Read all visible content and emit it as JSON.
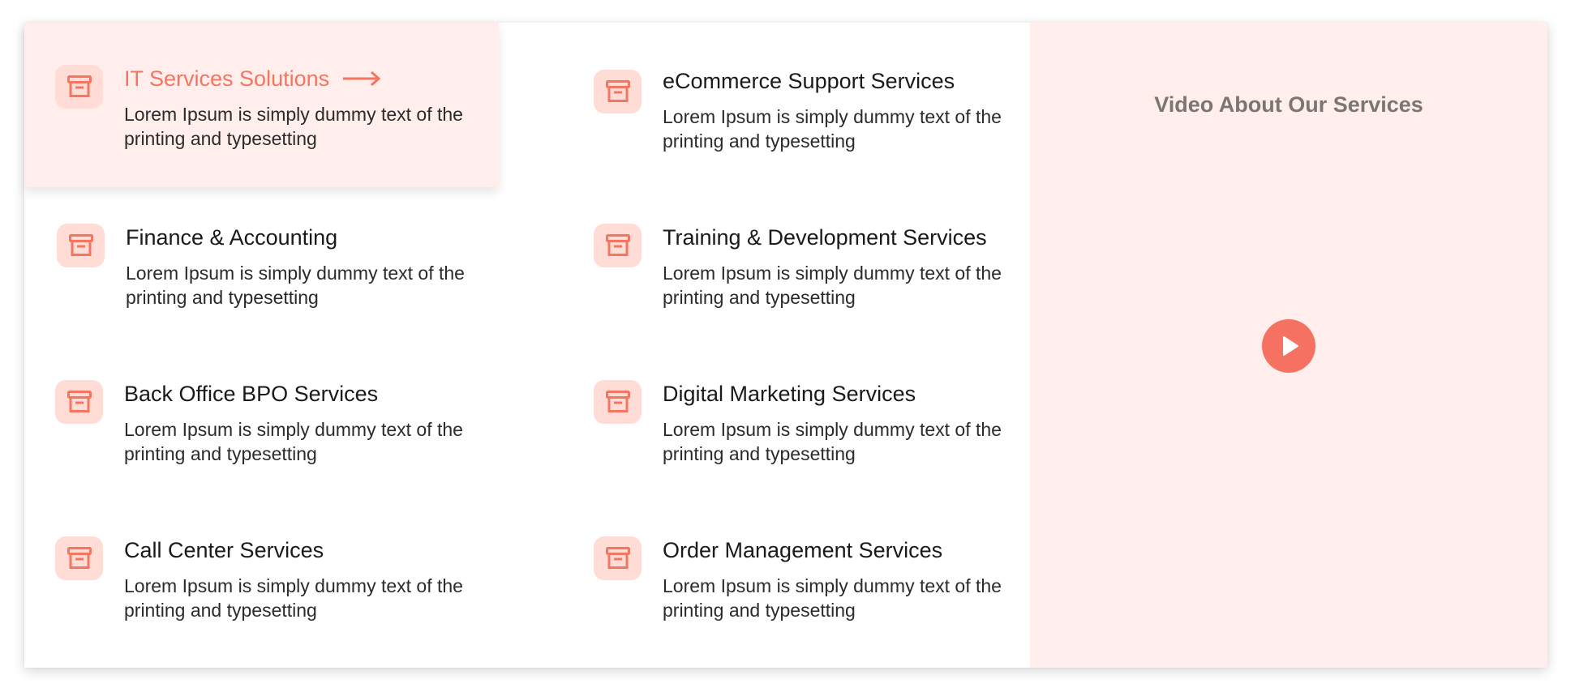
{
  "services": {
    "items": [
      {
        "title": "IT Services Solutions",
        "desc": "Lorem Ipsum is simply dummy text of the printing and typesetting",
        "active": true,
        "icon": "archive-box-icon"
      },
      {
        "title": "eCommerce Support Services",
        "desc": "Lorem Ipsum is simply dummy text of the printing and typesetting",
        "active": false,
        "icon": "archive-box-icon"
      },
      {
        "title": "Finance & Accounting",
        "desc": "Lorem Ipsum is simply dummy text of the printing and typesetting",
        "active": false,
        "icon": "archive-box-icon"
      },
      {
        "title": "Training & Development Services",
        "desc": "Lorem Ipsum is simply dummy text of the printing and typesetting",
        "active": false,
        "icon": "archive-box-icon"
      },
      {
        "title": "Back Office BPO Services",
        "desc": "Lorem Ipsum is simply dummy text of the printing and typesetting",
        "active": false,
        "icon": "archive-box-icon"
      },
      {
        "title": "Digital Marketing Services",
        "desc": "Lorem Ipsum is simply dummy text of the printing and typesetting",
        "active": false,
        "icon": "archive-box-icon"
      },
      {
        "title": "Call Center Services",
        "desc": "Lorem Ipsum is simply dummy text of the printing and typesetting",
        "active": false,
        "icon": "archive-box-icon"
      },
      {
        "title": "Order Management Services",
        "desc": "Lorem Ipsum is simply dummy text of the printing and typesetting",
        "active": false,
        "icon": "archive-box-icon"
      }
    ],
    "active_arrow_icon": "arrow-right-icon"
  },
  "video": {
    "title": "Video About Our Services",
    "play_icon": "play-icon"
  },
  "colors": {
    "accent": "#f47560",
    "icon_bg": "#ffddd6",
    "panel_bg": "#ffeeeb",
    "text": "#1a1a1a",
    "muted_title": "#7b7573"
  }
}
